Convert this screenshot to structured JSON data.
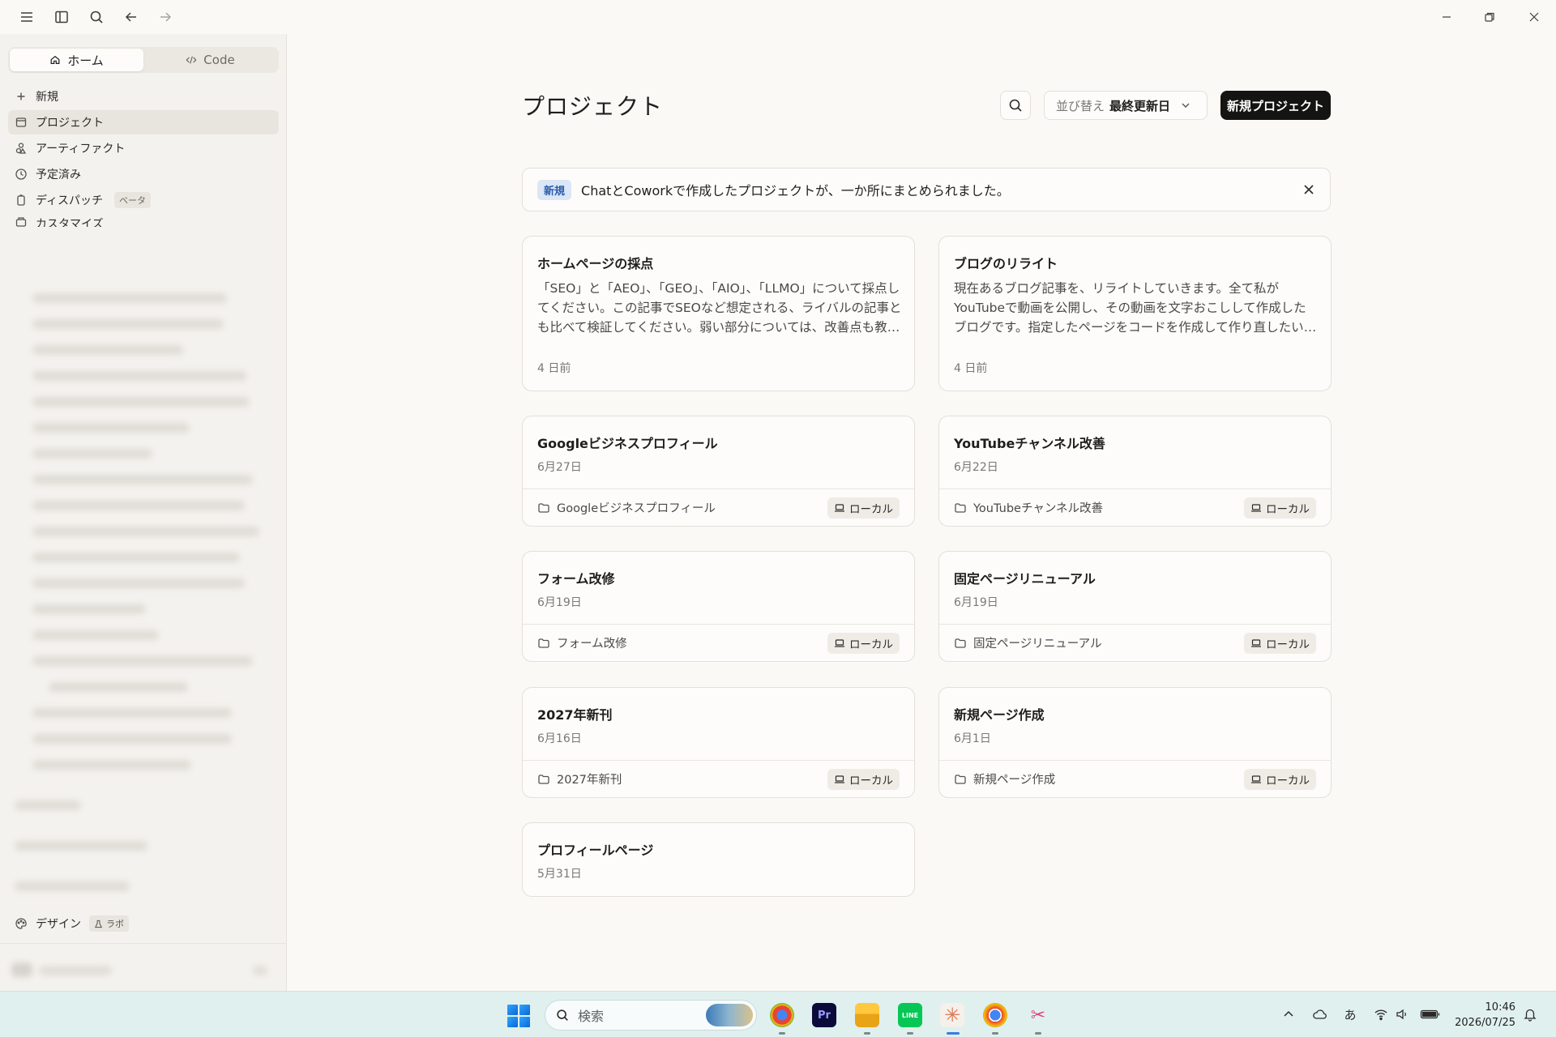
{
  "sidebar": {
    "mode_tabs": [
      {
        "label": "ホーム",
        "icon": "home-icon",
        "active": true
      },
      {
        "label": "Code",
        "icon": "code-icon",
        "active": false
      }
    ],
    "nav": [
      {
        "label": "新規",
        "icon": "plus-icon"
      },
      {
        "label": "プロジェクト",
        "icon": "projects-icon",
        "active": true
      },
      {
        "label": "アーティファクト",
        "icon": "artifacts-icon"
      },
      {
        "label": "予定済み",
        "icon": "clock-icon"
      },
      {
        "label": "ディスパッチ",
        "icon": "dispatch-icon",
        "badge": "ベータ"
      },
      {
        "label": "カスタマイズ",
        "icon": "customize-icon"
      }
    ],
    "design": {
      "label": "デザイン",
      "badge": "ラボ"
    }
  },
  "main": {
    "title": "プロジェクト",
    "sort": {
      "prefix": "並び替え",
      "value": "最終更新日"
    },
    "new_project_label": "新規プロジェクト",
    "banner": {
      "badge": "新規",
      "text": "ChatとCoworkで作成したプロジェクトが、一か所にまとめられました。"
    },
    "projects": [
      {
        "title": "ホームページの採点",
        "description": "「SEO」と「AEO」、「GEO」、「AIO」、「LLMO」について採点してください。この記事でSEOなど想定される、ライバルの記事とも比べて検証してください。弱い部分については、改善点も教えてください。",
        "date": "4 日前"
      },
      {
        "title": "ブログのリライト",
        "description": "現在あるブログ記事を、リライトしていきます。全て私がYouTubeで動画を公開し、その動画を文字おこしして作成したブログです。指定したページをコードを作成して作り直したいのですが 画像はそのまま…",
        "date": "4 日前"
      },
      {
        "title": "Googleビジネスプロフィール",
        "date": "6月27日",
        "folder": "Googleビジネスプロフィール",
        "location": "ローカル"
      },
      {
        "title": "YouTubeチャンネル改善",
        "date": "6月22日",
        "folder": "YouTubeチャンネル改善",
        "location": "ローカル"
      },
      {
        "title": "フォーム改修",
        "date": "6月19日",
        "folder": "フォーム改修",
        "location": "ローカル"
      },
      {
        "title": "固定ページリニューアル",
        "date": "6月19日",
        "folder": "固定ページリニューアル",
        "location": "ローカル"
      },
      {
        "title": "2027年新刊",
        "date": "6月16日",
        "folder": "2027年新刊",
        "location": "ローカル"
      },
      {
        "title": "新規ページ作成",
        "date": "6月1日",
        "folder": "新規ページ作成",
        "location": "ローカル"
      },
      {
        "title": "プロフィールページ",
        "date": "5月31日"
      }
    ]
  },
  "taskbar": {
    "search_placeholder": "検索",
    "apps": [
      {
        "name": "chrome-profile",
        "label": ""
      },
      {
        "name": "premiere-pro",
        "label": "Pr"
      },
      {
        "name": "file-explorer",
        "label": ""
      },
      {
        "name": "line",
        "label": "LINE"
      },
      {
        "name": "claude",
        "label": ""
      },
      {
        "name": "chrome",
        "label": ""
      },
      {
        "name": "snipping-tool",
        "label": ""
      }
    ],
    "ime": "あ",
    "time": "10:46",
    "date": "2026/07/25"
  }
}
